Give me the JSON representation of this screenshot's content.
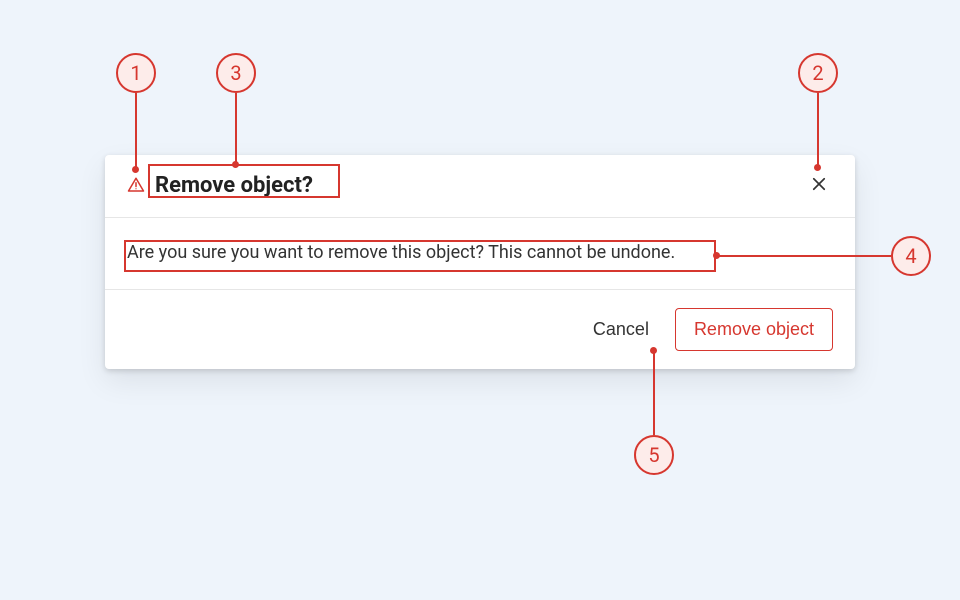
{
  "dialog": {
    "title": "Remove object?",
    "body": "Are you sure you want to remove this object? This cannot be undone.",
    "cancel_label": "Cancel",
    "confirm_label": "Remove object"
  },
  "annotations": {
    "n1": "1",
    "n2": "2",
    "n3": "3",
    "n4": "4",
    "n5": "5"
  },
  "colors": {
    "danger": "#d6372f",
    "background": "#eef4fb"
  }
}
